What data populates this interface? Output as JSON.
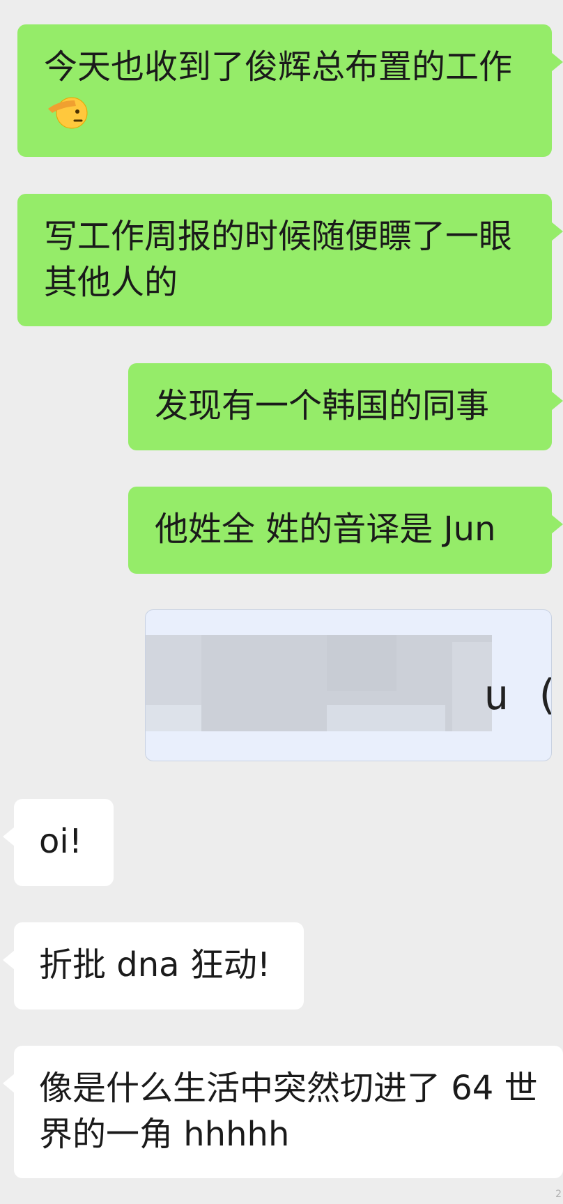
{
  "messages": [
    {
      "side": "outgoing",
      "text": "今天也收到了俊辉总布置的工作",
      "emoji": "saluting-face"
    },
    {
      "side": "outgoing",
      "text": "写工作周报的时候随便瞟了一眼其他人的"
    },
    {
      "side": "outgoing",
      "text": "发现有一个韩国的同事"
    },
    {
      "side": "outgoing",
      "text": "他姓全 姓的音译是 Jun"
    },
    {
      "side": "outgoing",
      "type": "image",
      "visible_text": "u (:"
    },
    {
      "side": "incoming",
      "text": "oi!"
    },
    {
      "side": "incoming",
      "text": "折批 dna 狂动!"
    },
    {
      "side": "incoming",
      "text": "像是什么生活中突然切进了 64 世界的一角 hhhhh"
    }
  ],
  "corner_mark": "2",
  "colors": {
    "background": "#ededed",
    "outgoing_bubble": "#95ec69",
    "incoming_bubble": "#ffffff",
    "text": "#1a1a1a"
  }
}
